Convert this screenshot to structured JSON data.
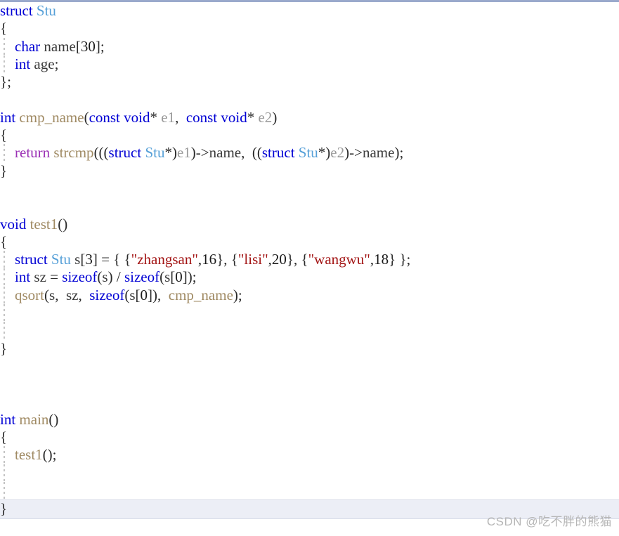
{
  "editor": {
    "language": "C",
    "font_size_px": 21,
    "line_height_px": 25.3,
    "background": "#ffffff",
    "top_border_color": "#9aa9cc",
    "highlight_row_color": "#eceef6",
    "indent_guide_color": "#c4c4c4"
  },
  "colors": {
    "keyword": "#0000d4",
    "type": "#56a0d8",
    "function": "#a08a63",
    "parameter": "#9a9a9a",
    "return_keyword": "#9b30b5",
    "string": "#a31515",
    "number": "#1a1a1a",
    "identifier": "#3b3b3b",
    "punctuation": "#2b2b2b",
    "watermark": "#b6b6b6"
  },
  "code": {
    "lines": [
      {
        "n": 1,
        "guide": false,
        "highlight": false,
        "tokens": [
          {
            "t": "struct",
            "c": "kw"
          },
          {
            "t": " ",
            "c": "plain"
          },
          {
            "t": "Stu",
            "c": "type"
          }
        ]
      },
      {
        "n": 2,
        "guide": false,
        "highlight": false,
        "tokens": [
          {
            "t": "{",
            "c": "punc"
          }
        ]
      },
      {
        "n": 3,
        "guide": true,
        "highlight": false,
        "tokens": [
          {
            "t": "    ",
            "c": "plain"
          },
          {
            "t": "char",
            "c": "kw"
          },
          {
            "t": " ",
            "c": "plain"
          },
          {
            "t": "name",
            "c": "ident"
          },
          {
            "t": "[",
            "c": "punc"
          },
          {
            "t": "30",
            "c": "num"
          },
          {
            "t": "]",
            "c": "punc"
          },
          {
            "t": ";",
            "c": "punc"
          }
        ]
      },
      {
        "n": 4,
        "guide": true,
        "highlight": false,
        "tokens": [
          {
            "t": "    ",
            "c": "plain"
          },
          {
            "t": "int",
            "c": "kw"
          },
          {
            "t": " ",
            "c": "plain"
          },
          {
            "t": "age",
            "c": "ident"
          },
          {
            "t": ";",
            "c": "punc"
          }
        ]
      },
      {
        "n": 5,
        "guide": false,
        "highlight": false,
        "tokens": [
          {
            "t": "}",
            "c": "punc"
          },
          {
            "t": ";",
            "c": "punc"
          }
        ]
      },
      {
        "n": 6,
        "guide": false,
        "highlight": false,
        "tokens": []
      },
      {
        "n": 7,
        "guide": false,
        "highlight": false,
        "tokens": [
          {
            "t": "int",
            "c": "kw"
          },
          {
            "t": " ",
            "c": "plain"
          },
          {
            "t": "cmp_name",
            "c": "fn"
          },
          {
            "t": "(",
            "c": "punc"
          },
          {
            "t": "const",
            "c": "kw"
          },
          {
            "t": " ",
            "c": "plain"
          },
          {
            "t": "void",
            "c": "kw"
          },
          {
            "t": "*",
            "c": "punc"
          },
          {
            "t": " ",
            "c": "plain"
          },
          {
            "t": "e1",
            "c": "param"
          },
          {
            "t": ", ",
            "c": "punc"
          },
          {
            "t": " ",
            "c": "plain"
          },
          {
            "t": "const",
            "c": "kw"
          },
          {
            "t": " ",
            "c": "plain"
          },
          {
            "t": "void",
            "c": "kw"
          },
          {
            "t": "*",
            "c": "punc"
          },
          {
            "t": " ",
            "c": "plain"
          },
          {
            "t": "e2",
            "c": "param"
          },
          {
            "t": ")",
            "c": "punc"
          }
        ]
      },
      {
        "n": 8,
        "guide": false,
        "highlight": false,
        "tokens": [
          {
            "t": "{",
            "c": "punc"
          }
        ]
      },
      {
        "n": 9,
        "guide": true,
        "highlight": false,
        "tokens": [
          {
            "t": "    ",
            "c": "plain"
          },
          {
            "t": "return",
            "c": "ret"
          },
          {
            "t": " ",
            "c": "plain"
          },
          {
            "t": "strcmp",
            "c": "fn"
          },
          {
            "t": "(((",
            "c": "punc"
          },
          {
            "t": "struct",
            "c": "kw"
          },
          {
            "t": " ",
            "c": "plain"
          },
          {
            "t": "Stu",
            "c": "type"
          },
          {
            "t": "*)",
            "c": "punc"
          },
          {
            "t": "e1",
            "c": "param"
          },
          {
            "t": ")->",
            "c": "punc"
          },
          {
            "t": "name",
            "c": "ident"
          },
          {
            "t": ", ",
            "c": "punc"
          },
          {
            "t": " ((",
            "c": "punc"
          },
          {
            "t": "struct",
            "c": "kw"
          },
          {
            "t": " ",
            "c": "plain"
          },
          {
            "t": "Stu",
            "c": "type"
          },
          {
            "t": "*)",
            "c": "punc"
          },
          {
            "t": "e2",
            "c": "param"
          },
          {
            "t": ")->",
            "c": "punc"
          },
          {
            "t": "name",
            "c": "ident"
          },
          {
            "t": ");",
            "c": "punc"
          }
        ]
      },
      {
        "n": 10,
        "guide": false,
        "highlight": false,
        "tokens": [
          {
            "t": "}",
            "c": "punc"
          }
        ]
      },
      {
        "n": 11,
        "guide": false,
        "highlight": false,
        "tokens": []
      },
      {
        "n": 12,
        "guide": false,
        "highlight": false,
        "tokens": []
      },
      {
        "n": 13,
        "guide": false,
        "highlight": false,
        "tokens": [
          {
            "t": "void",
            "c": "kw"
          },
          {
            "t": " ",
            "c": "plain"
          },
          {
            "t": "test1",
            "c": "fn"
          },
          {
            "t": "()",
            "c": "punc"
          }
        ]
      },
      {
        "n": 14,
        "guide": false,
        "highlight": false,
        "tokens": [
          {
            "t": "{",
            "c": "punc"
          }
        ]
      },
      {
        "n": 15,
        "guide": true,
        "highlight": false,
        "tokens": [
          {
            "t": "    ",
            "c": "plain"
          },
          {
            "t": "struct",
            "c": "kw"
          },
          {
            "t": " ",
            "c": "plain"
          },
          {
            "t": "Stu",
            "c": "type"
          },
          {
            "t": " ",
            "c": "plain"
          },
          {
            "t": "s",
            "c": "ident"
          },
          {
            "t": "[",
            "c": "punc"
          },
          {
            "t": "3",
            "c": "num"
          },
          {
            "t": "]",
            "c": "punc"
          },
          {
            "t": " = { {",
            "c": "punc"
          },
          {
            "t": "\"zhangsan\"",
            "c": "str"
          },
          {
            "t": ",",
            "c": "punc"
          },
          {
            "t": "16",
            "c": "num"
          },
          {
            "t": "}, {",
            "c": "punc"
          },
          {
            "t": "\"lisi\"",
            "c": "str"
          },
          {
            "t": ",",
            "c": "punc"
          },
          {
            "t": "20",
            "c": "num"
          },
          {
            "t": "}, {",
            "c": "punc"
          },
          {
            "t": "\"wangwu\"",
            "c": "str"
          },
          {
            "t": ",",
            "c": "punc"
          },
          {
            "t": "18",
            "c": "num"
          },
          {
            "t": "} };",
            "c": "punc"
          }
        ]
      },
      {
        "n": 16,
        "guide": true,
        "highlight": false,
        "tokens": [
          {
            "t": "    ",
            "c": "plain"
          },
          {
            "t": "int",
            "c": "kw"
          },
          {
            "t": " ",
            "c": "plain"
          },
          {
            "t": "sz",
            "c": "ident"
          },
          {
            "t": " = ",
            "c": "punc"
          },
          {
            "t": "sizeof",
            "c": "kw"
          },
          {
            "t": "(",
            "c": "punc"
          },
          {
            "t": "s",
            "c": "ident"
          },
          {
            "t": ")",
            "c": "punc"
          },
          {
            "t": " / ",
            "c": "punc"
          },
          {
            "t": "sizeof",
            "c": "kw"
          },
          {
            "t": "(",
            "c": "punc"
          },
          {
            "t": "s",
            "c": "ident"
          },
          {
            "t": "[",
            "c": "punc"
          },
          {
            "t": "0",
            "c": "num"
          },
          {
            "t": "]",
            "c": "punc"
          },
          {
            "t": ");",
            "c": "punc"
          }
        ]
      },
      {
        "n": 17,
        "guide": true,
        "highlight": false,
        "tokens": [
          {
            "t": "    ",
            "c": "plain"
          },
          {
            "t": "qsort",
            "c": "fn"
          },
          {
            "t": "(",
            "c": "punc"
          },
          {
            "t": "s",
            "c": "ident"
          },
          {
            "t": ", ",
            "c": "punc"
          },
          {
            "t": " ",
            "c": "plain"
          },
          {
            "t": "sz",
            "c": "ident"
          },
          {
            "t": ", ",
            "c": "punc"
          },
          {
            "t": " ",
            "c": "plain"
          },
          {
            "t": "sizeof",
            "c": "kw"
          },
          {
            "t": "(",
            "c": "punc"
          },
          {
            "t": "s",
            "c": "ident"
          },
          {
            "t": "[",
            "c": "punc"
          },
          {
            "t": "0",
            "c": "num"
          },
          {
            "t": "]",
            "c": "punc"
          },
          {
            "t": "), ",
            "c": "punc"
          },
          {
            "t": " ",
            "c": "plain"
          },
          {
            "t": "cmp_name",
            "c": "fn"
          },
          {
            "t": ");",
            "c": "punc"
          }
        ]
      },
      {
        "n": 18,
        "guide": true,
        "highlight": false,
        "tokens": []
      },
      {
        "n": 19,
        "guide": true,
        "highlight": false,
        "tokens": []
      },
      {
        "n": 20,
        "guide": false,
        "highlight": false,
        "tokens": [
          {
            "t": "}",
            "c": "punc"
          }
        ]
      },
      {
        "n": 21,
        "guide": false,
        "highlight": false,
        "tokens": []
      },
      {
        "n": 22,
        "guide": false,
        "highlight": false,
        "tokens": []
      },
      {
        "n": 23,
        "guide": false,
        "highlight": false,
        "tokens": []
      },
      {
        "n": 24,
        "guide": false,
        "highlight": false,
        "tokens": [
          {
            "t": "int",
            "c": "kw"
          },
          {
            "t": " ",
            "c": "plain"
          },
          {
            "t": "main",
            "c": "fn"
          },
          {
            "t": "()",
            "c": "punc"
          }
        ]
      },
      {
        "n": 25,
        "guide": false,
        "highlight": false,
        "tokens": [
          {
            "t": "{",
            "c": "punc"
          }
        ]
      },
      {
        "n": 26,
        "guide": true,
        "highlight": false,
        "tokens": [
          {
            "t": "    ",
            "c": "plain"
          },
          {
            "t": "test1",
            "c": "fn"
          },
          {
            "t": "();",
            "c": "punc"
          }
        ]
      },
      {
        "n": 27,
        "guide": true,
        "highlight": false,
        "tokens": []
      },
      {
        "n": 28,
        "guide": true,
        "highlight": false,
        "tokens": []
      },
      {
        "n": 29,
        "guide": false,
        "highlight": true,
        "tokens": [
          {
            "t": "}",
            "c": "punc"
          }
        ]
      }
    ]
  },
  "watermark": {
    "text": "CSDN @吃不胖的熊猫"
  }
}
